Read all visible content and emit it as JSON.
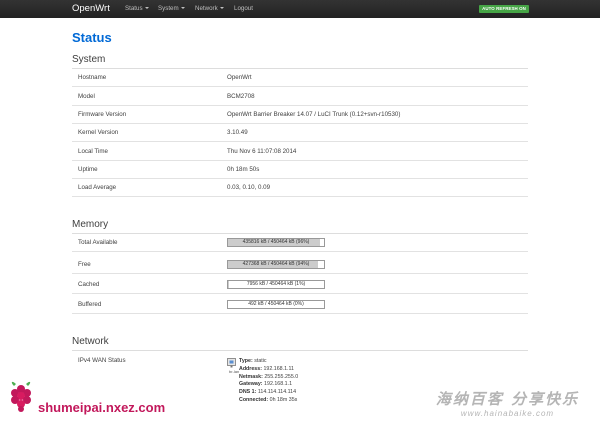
{
  "nav": {
    "brand": "OpenWrt",
    "menus": [
      "Status",
      "System",
      "Network",
      "Logout"
    ],
    "auto_refresh": "AUTO REFRESH ON"
  },
  "page": {
    "title": "Status"
  },
  "system": {
    "title": "System",
    "rows": [
      {
        "key": "Hostname",
        "value": "OpenWrt"
      },
      {
        "key": "Model",
        "value": "BCM2708"
      },
      {
        "key": "Firmware Version",
        "value": "OpenWrt Barrier Breaker 14.07 / LuCI Trunk (0.12+svn-r10530)"
      },
      {
        "key": "Kernel Version",
        "value": "3.10.49"
      },
      {
        "key": "Local Time",
        "value": "Thu Nov 6 11:07:08 2014"
      },
      {
        "key": "Uptime",
        "value": "0h 18m 50s"
      },
      {
        "key": "Load Average",
        "value": "0.03, 0.10, 0.09"
      }
    ]
  },
  "memory": {
    "title": "Memory",
    "rows": [
      {
        "key": "Total Available",
        "bar_text": "435816 kB / 450464 kB (96%)",
        "percent": 96
      },
      {
        "key": "Free",
        "bar_text": "427368 kB / 450464 kB (94%)",
        "percent": 94
      },
      {
        "key": "Cached",
        "bar_text": "7956 kB / 450464 kB (1%)",
        "percent": 1
      },
      {
        "key": "Buffered",
        "bar_text": "492 kB / 450464 kB (0%)",
        "percent": 0
      }
    ]
  },
  "network": {
    "title": "Network",
    "wan_label": "IPv4 WAN Status",
    "wan_port": "br-lan",
    "wan": [
      {
        "label": "Type:",
        "value": "static"
      },
      {
        "label": "Address:",
        "value": "192.168.1.11"
      },
      {
        "label": "Netmask:",
        "value": "255.255.255.0"
      },
      {
        "label": "Gateway:",
        "value": "192.168.1.1"
      },
      {
        "label": "DNS 1:",
        "value": "114.114.114.114"
      },
      {
        "label": "Connected:",
        "value": "0h 18m 35s"
      }
    ]
  },
  "watermark": {
    "left_text": "shumeipai.nxez.com",
    "right_text": "海纳百客 分享快乐",
    "right_url": "www.hainabaike.com"
  },
  "colors": {
    "title_blue": "#0069d6",
    "refresh_green": "#46a546",
    "navbar": "#222222"
  }
}
